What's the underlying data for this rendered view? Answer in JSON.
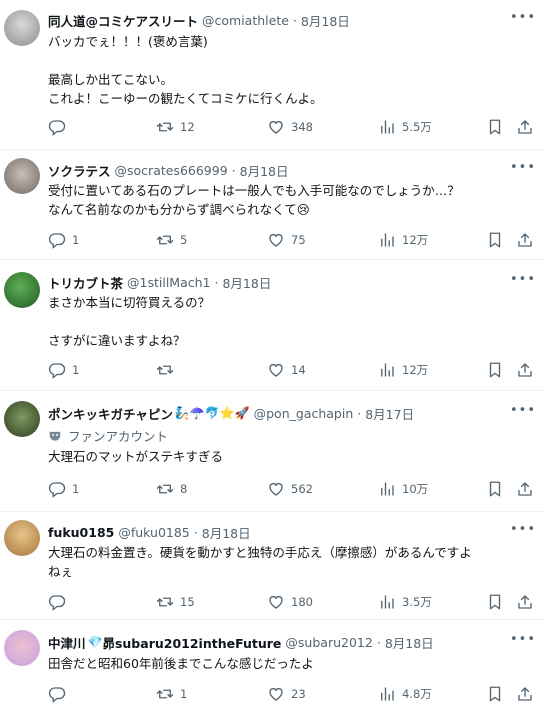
{
  "replies": [
    {
      "name": "同人道@コミケアスリート",
      "handle": "@comiathlete",
      "dot": "·",
      "time": "8月18日",
      "lines": [
        "バッカでぇ！！！(褒め言葉)",
        "",
        "最高しか出てこない。",
        "これよ！こーゆーの観たくてコミケに行くんよ。"
      ],
      "stats": {
        "replies": "",
        "retweets": "12",
        "likes": "348",
        "views": "5.5万"
      }
    },
    {
      "name": "ソクラテス",
      "handle": "@socrates666999",
      "dot": "·",
      "time": "8月18日",
      "lines": [
        "受付に置いてある石のプレートは一般人でも入手可能なのでしょうか…？",
        "なんて名前なのかも分からず調べられなくて😢"
      ],
      "stats": {
        "replies": "1",
        "retweets": "5",
        "likes": "75",
        "views": "12万"
      }
    },
    {
      "name": "トリカブト茶",
      "handle": "@1stillMach1",
      "dot": "·",
      "time": "8月18日",
      "lines": [
        "まさか本当に切符買えるの？",
        "",
        "さすがに違いますよね？"
      ],
      "stats": {
        "replies": "1",
        "retweets": "",
        "likes": "14",
        "views": "12万"
      }
    },
    {
      "name": "ポンキッキガチャピン",
      "name_emoji": "🧞☂️🐬⭐🚀",
      "handle": "@pon_gachapin",
      "dot": "·",
      "time": "8月17日",
      "community": "ファンアカウント",
      "lines": [
        "大理石のマットがステキすぎる"
      ],
      "stats": {
        "replies": "1",
        "retweets": "8",
        "likes": "562",
        "views": "10万"
      }
    },
    {
      "name": "fuku0185",
      "handle": "@fuku0185",
      "dot": "·",
      "time": "8月18日",
      "lines": [
        "大理石の料金置き。硬貨を動かすと独特の手応え（摩擦感）があるんですよ",
        "ねぇ"
      ],
      "stats": {
        "replies": "",
        "retweets": "15",
        "likes": "180",
        "views": "3.5万"
      }
    },
    {
      "name": "中津川",
      "name_emoji": "💎",
      "name_suffix": "昴subaru2012intheFuture",
      "handle": "@subaru2012",
      "dot": "·",
      "time": "8月18日",
      "lines": [
        "田舎だと昭和60年前後までこんな感じだったよ"
      ],
      "stats": {
        "replies": "",
        "retweets": "1",
        "likes": "23",
        "views": "4.8万"
      }
    }
  ],
  "icons": {
    "more": "more-icon",
    "reply": "reply-icon",
    "retweet": "retweet-icon",
    "like": "like-icon",
    "views": "views-icon",
    "bookmark": "bookmark-icon",
    "share": "share-icon"
  },
  "colors": {
    "text": "#0f1419",
    "secondary": "#536471",
    "border": "#eff3f4"
  },
  "more_label": "•••"
}
